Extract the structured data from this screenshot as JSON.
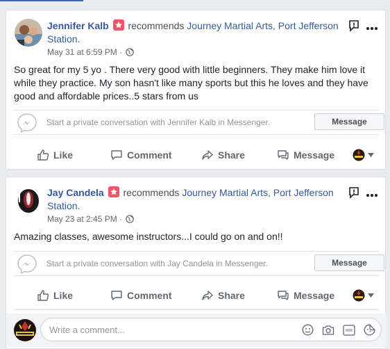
{
  "colors": {
    "link": "#365899",
    "brand": "#4267b2",
    "recommend_badge": "#f35369"
  },
  "posts": [
    {
      "author": "Jennifer Kalb",
      "action": "recommends",
      "page": "Journey Martial Arts, Port Jefferson Station.",
      "date": "May 31 at 6:59 PM",
      "dot": "·",
      "privacy_icon": "globe-icon",
      "text": "So great for my 5 yo . There very good with little beginners. They make him love it while they practice. My son hasn't like many sports but this he loves and they have good and affordable prices..5 stars from us",
      "messenger_prompt": "Start a private conversation with Jennifer Kalb in Messenger.",
      "message_button": "Message"
    },
    {
      "author": "Jay Candela",
      "action": "recommends",
      "page": "Journey Martial Arts, Port Jefferson Station.",
      "date": "May 23 at 2:45 PM",
      "dot": "·",
      "privacy_icon": "globe-icon",
      "text": "Amazing classes, awesome instructors...I could go on and on!!",
      "messenger_prompt": "Start a private conversation with Jay Candela in Messenger.",
      "message_button": "Message"
    }
  ],
  "actions": {
    "like": "Like",
    "comment": "Comment",
    "share": "Share",
    "message": "Message"
  },
  "comment_box": {
    "placeholder": "Write a comment..."
  }
}
